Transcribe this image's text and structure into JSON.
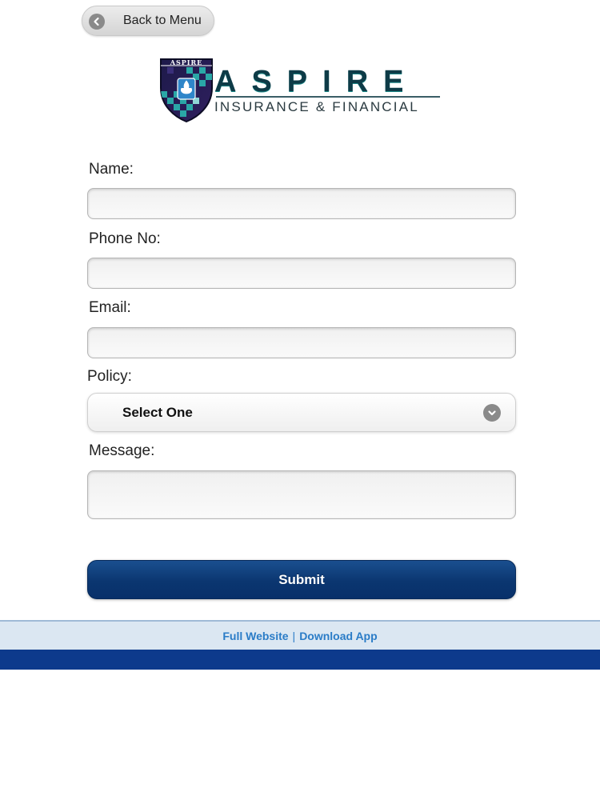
{
  "header": {
    "back_label": "Back to Menu"
  },
  "logo": {
    "seal_text": "ASPIRE",
    "wordmark": "ASPIRE",
    "tagline": "INSURANCE & FINANCIAL"
  },
  "form": {
    "name_label": "Name:",
    "name_value": "",
    "phone_label": "Phone No:",
    "phone_value": "",
    "email_label": "Email:",
    "email_value": "",
    "policy_label": "Policy:",
    "policy_selected": "Select One",
    "message_label": "Message:",
    "message_value": "",
    "submit_label": "Submit"
  },
  "footer": {
    "full_website_label": "Full Website",
    "separator": "|",
    "download_app_label": "Download App"
  },
  "colors": {
    "brand_navy": "#0b3670",
    "footer_link": "#2a7cc7",
    "footer_strip": "#0d3a8c"
  },
  "icons": {
    "back": "arrow-left-circle-icon",
    "select": "chevron-down-circle-icon"
  }
}
